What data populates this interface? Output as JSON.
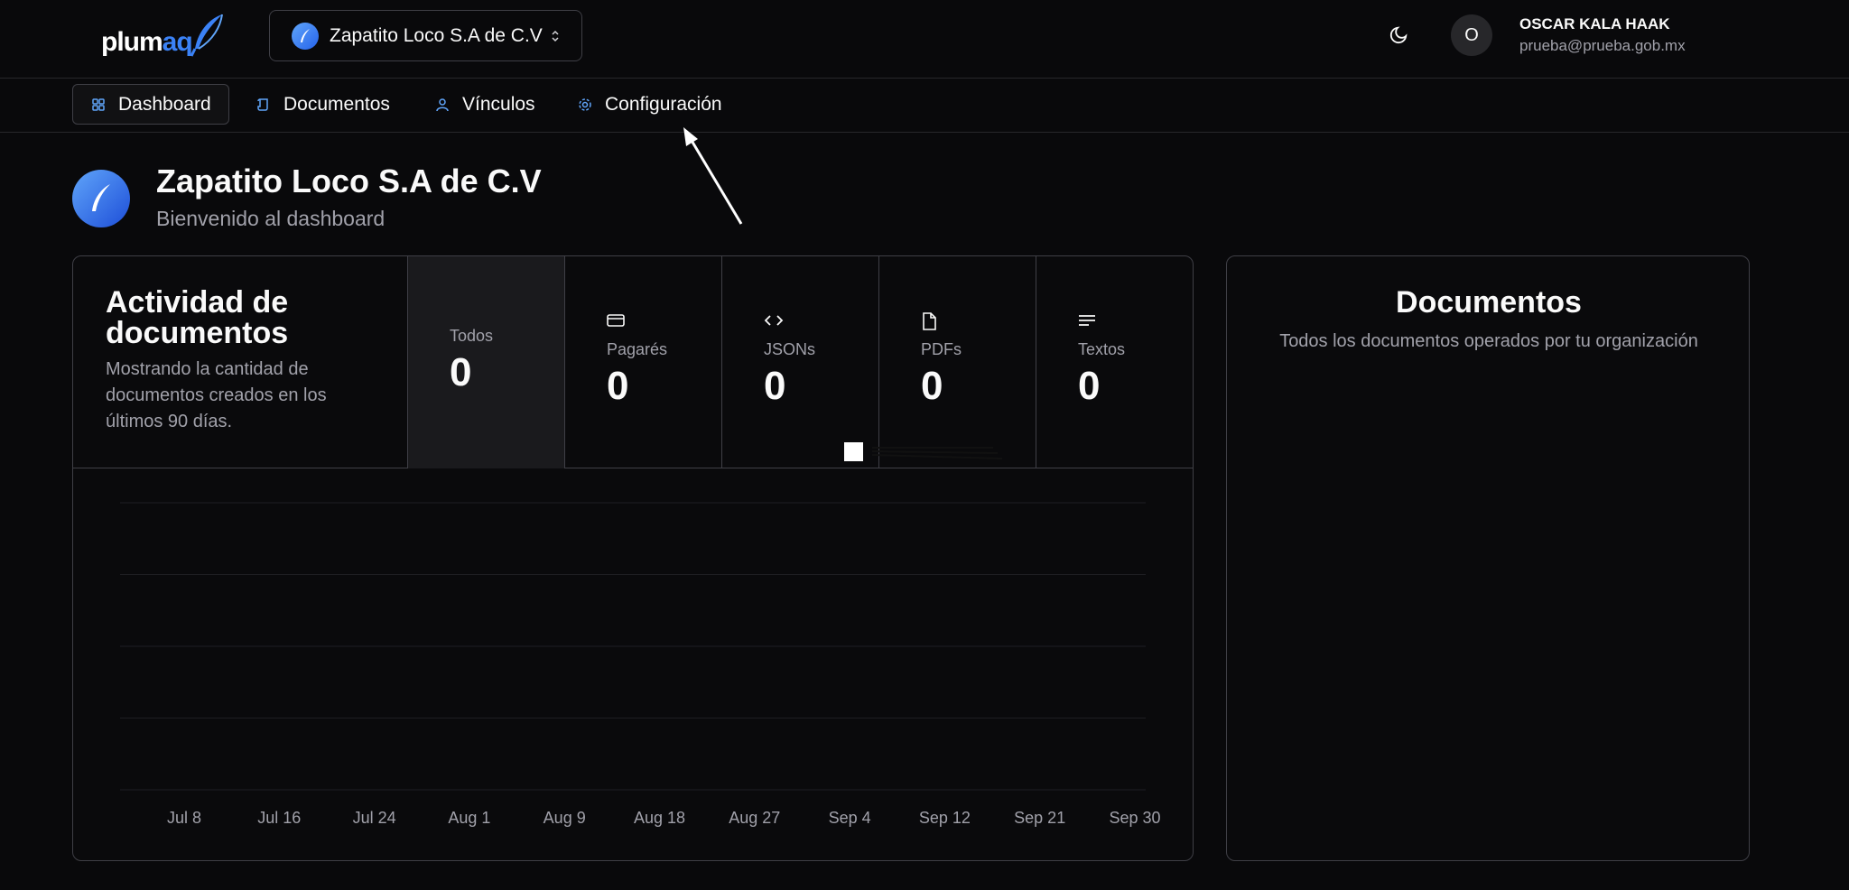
{
  "brand": {
    "logo_main": "plum",
    "logo_accent": "aq"
  },
  "org_switcher": {
    "name": "Zapatito Loco S.A de C.V"
  },
  "user": {
    "initial": "O",
    "name": "OSCAR KALA HAAK",
    "email": "prueba@prueba.gob.mx"
  },
  "nav": {
    "items": [
      {
        "label": "Dashboard",
        "icon": "grid-icon"
      },
      {
        "label": "Documentos",
        "icon": "scroll-icon"
      },
      {
        "label": "Vínculos",
        "icon": "user-icon"
      },
      {
        "label": "Configuración",
        "icon": "gear-icon"
      }
    ],
    "active": "Dashboard"
  },
  "page": {
    "title": "Zapatito Loco S.A de C.V",
    "subtitle": "Bienvenido al dashboard"
  },
  "activity": {
    "title": "Actividad de documentos",
    "description": "Mostrando la cantidad de documentos creados en los últimos 90 días.",
    "stats": [
      {
        "label": "Todos",
        "value": "0",
        "icon": ""
      },
      {
        "label": "Pagarés",
        "value": "0",
        "icon": "card-icon"
      },
      {
        "label": "JSONs",
        "value": "0",
        "icon": "code-icon"
      },
      {
        "label": "PDFs",
        "value": "0",
        "icon": "file-icon"
      },
      {
        "label": "Textos",
        "value": "0",
        "icon": "text-lines-icon"
      }
    ]
  },
  "chart_data": {
    "type": "area",
    "x": [
      "Jul 8",
      "Jul 16",
      "Jul 24",
      "Aug 1",
      "Aug 9",
      "Aug 18",
      "Aug 27",
      "Sep 4",
      "Sep 12",
      "Sep 21",
      "Sep 30"
    ],
    "values": [
      0,
      0,
      0,
      0,
      0,
      0,
      0,
      0,
      0,
      0,
      0
    ],
    "grid": true,
    "title": "",
    "xlabel": "",
    "ylabel": ""
  },
  "documents_panel": {
    "title": "Documentos",
    "description": "Todos los documentos operados por tu organización"
  },
  "colors": {
    "accent": "#3b82f6",
    "background": "#09090b",
    "border": "#3f3f46",
    "muted": "#a1a1aa"
  }
}
